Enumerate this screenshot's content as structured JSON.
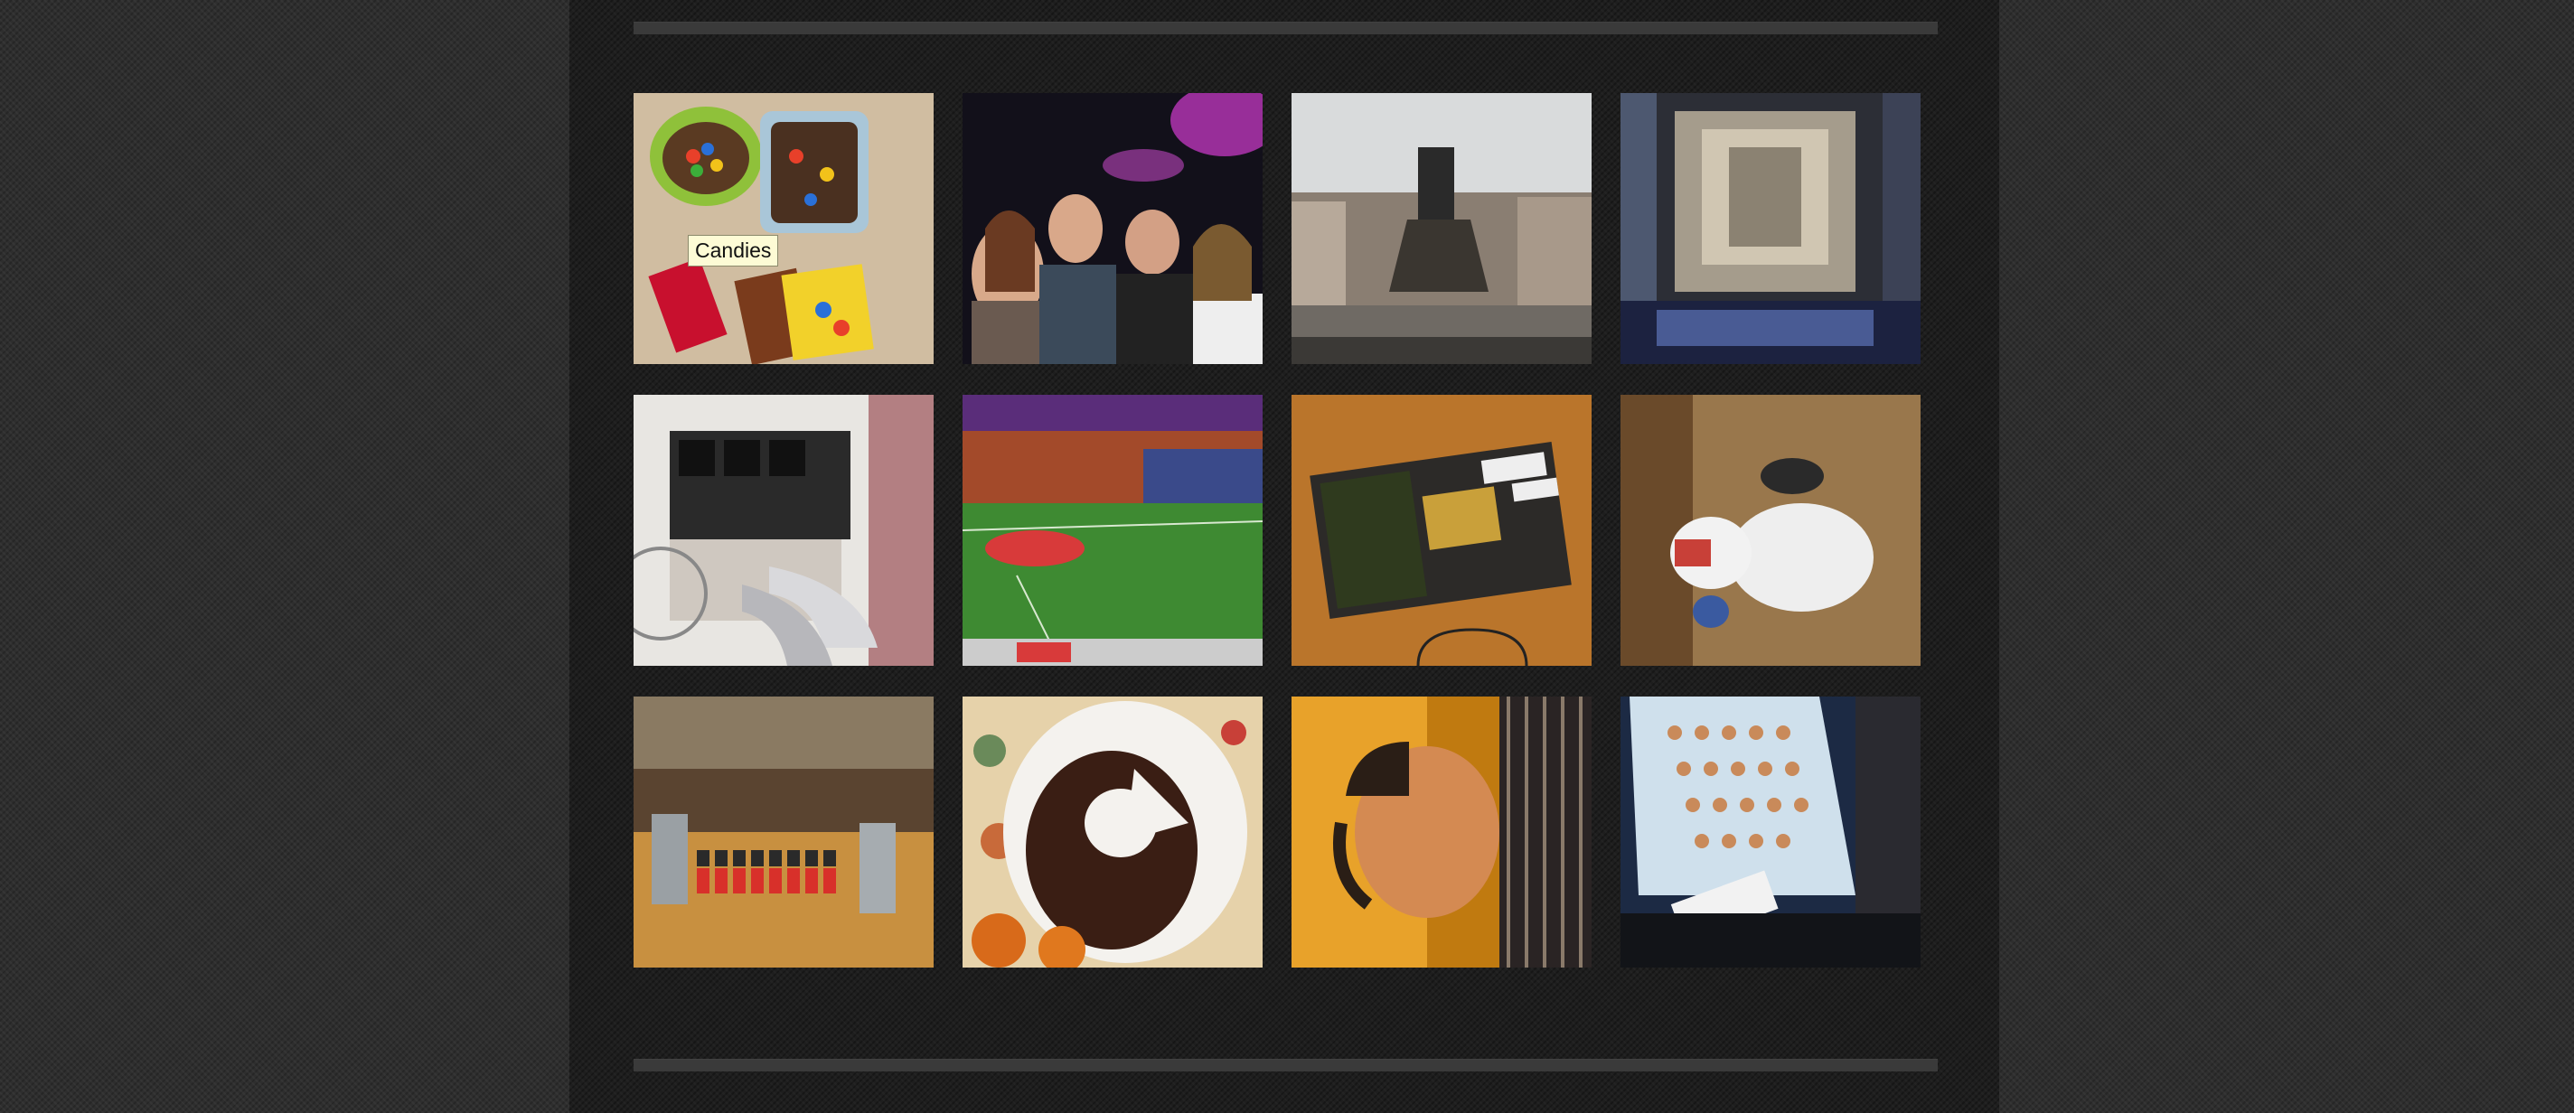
{
  "gallery": {
    "tooltip": "Candies",
    "photos": [
      {
        "id": "candies",
        "title": "Candies"
      },
      {
        "id": "friends-club"
      },
      {
        "id": "piazza-statue"
      },
      {
        "id": "cathedral-interior"
      },
      {
        "id": "ferrari-engine"
      },
      {
        "id": "stadium"
      },
      {
        "id": "tickets"
      },
      {
        "id": "snowman"
      },
      {
        "id": "shots-bar"
      },
      {
        "id": "cake"
      },
      {
        "id": "selfie"
      },
      {
        "id": "diner-cups"
      }
    ]
  }
}
